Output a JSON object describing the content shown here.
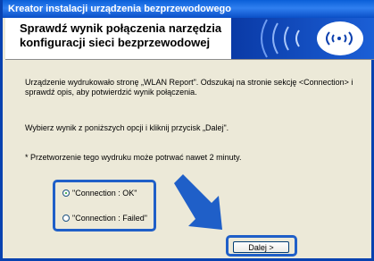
{
  "window": {
    "title": "Kreator instalacji urządzenia bezprzewodowego"
  },
  "header": {
    "title_line1": "Sprawdź wynik połączenia narzędzia",
    "title_line2": "konfiguracji sieci bezprzewodowej"
  },
  "content": {
    "paragraph1": "Urządzenie wydrukowało stronę „WLAN Report\". Odszukaj na stronie sekcję <Connection> i sprawdź opis, aby potwierdzić wynik połączenia.",
    "paragraph2": "Wybierz wynik z poniższych opcji i kliknij przycisk „Dalej\".",
    "paragraph3": "* Przetworzenie tego wydruku może potrwać nawet 2 minuty."
  },
  "options": [
    {
      "label": "\"Connection : OK\"",
      "selected": true
    },
    {
      "label": "\"Connection : Failed\"",
      "selected": false
    }
  ],
  "buttons": {
    "next_label": "Dalej >"
  },
  "colors": {
    "title_bar": "#0a5fd8",
    "highlight": "#1f5fc8",
    "header_graphic": "#0b3fae"
  }
}
